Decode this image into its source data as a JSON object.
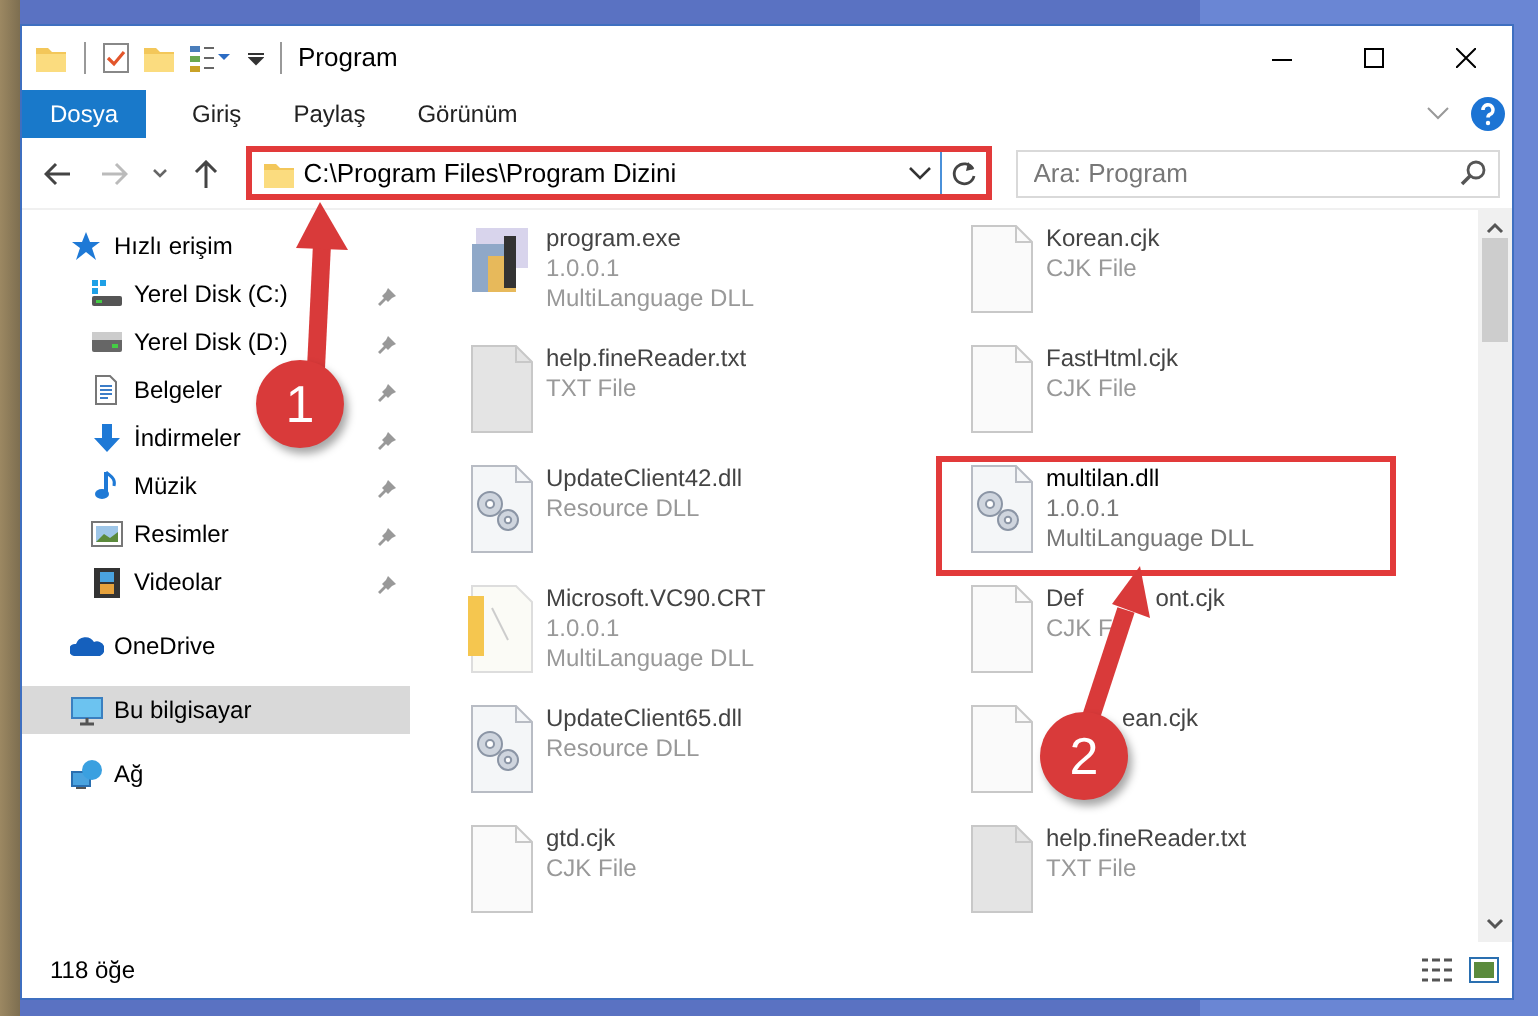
{
  "window": {
    "title": "Program"
  },
  "ribbon_tabs": [
    {
      "label": "Dosya",
      "selected": true
    },
    {
      "label": "Giriş",
      "selected": false
    },
    {
      "label": "Paylaş",
      "selected": false
    },
    {
      "label": "Görünüm",
      "selected": false
    }
  ],
  "address": {
    "path": "C:\\Program Files\\Program Dizini",
    "highlighted": true
  },
  "search": {
    "placeholder": "Ara: Program"
  },
  "nav": [
    {
      "label": "Hızlı erişim",
      "kind": "quick",
      "selected": false,
      "children": [
        {
          "label": "Yerel Disk (C:)",
          "kind": "system-drive",
          "pinned": true,
          "selected": false
        },
        {
          "label": "Yerel Disk (D:)",
          "kind": "drive",
          "pinned": true,
          "selected": false
        },
        {
          "label": "Belgeler",
          "kind": "documents",
          "pinned": true,
          "selected": false
        },
        {
          "label": "İndirmeler",
          "kind": "downloads",
          "pinned": true,
          "selected": false
        },
        {
          "label": "Müzik",
          "kind": "music",
          "pinned": true,
          "selected": false
        },
        {
          "label": "Resimler",
          "kind": "pictures",
          "pinned": true,
          "selected": false
        },
        {
          "label": "Videolar",
          "kind": "videos",
          "pinned": true,
          "selected": false
        }
      ]
    },
    {
      "label": "OneDrive",
      "kind": "cloud",
      "selected": false
    },
    {
      "label": "Bu bilgisayar",
      "kind": "computer",
      "selected": true
    },
    {
      "label": "Ağ",
      "kind": "network",
      "selected": false
    }
  ],
  "files": [
    {
      "name": "program.exe",
      "details": [
        "1.0.0.1",
        "MultiLanguage DLL"
      ],
      "kind": "exe",
      "highlighted": false
    },
    {
      "name": "Korean.cjk",
      "details": [
        "CJK File"
      ],
      "kind": "blank",
      "highlighted": false
    },
    {
      "name": "help.fineReader.txt",
      "details": [
        "TXT File"
      ],
      "kind": "text",
      "highlighted": false
    },
    {
      "name": "FastHtml.cjk",
      "details": [
        "CJK File"
      ],
      "kind": "blank",
      "highlighted": false
    },
    {
      "name": "UpdateClient42.dll",
      "details": [
        "Resource DLL"
      ],
      "kind": "dll",
      "highlighted": false
    },
    {
      "name": "multilan.dll",
      "details": [
        "1.0.0.1",
        "MultiLanguage DLL"
      ],
      "kind": "dll",
      "highlighted": true
    },
    {
      "name": "Microsoft.VC90.CRT",
      "details": [
        "1.0.0.1",
        "MultiLanguage DLL"
      ],
      "kind": "folder",
      "highlighted": false
    },
    {
      "name": "Def",
      "name_end": "ont.cjk",
      "details": [
        "CJK F"
      ],
      "kind": "blank",
      "highlighted": false
    },
    {
      "name": "UpdateClient65.dll",
      "details": [
        "Resource DLL"
      ],
      "kind": "dll",
      "highlighted": false
    },
    {
      "name_end": "ean.cjk",
      "kind": "blank",
      "highlighted": false
    },
    {
      "name": "gtd.cjk",
      "details": [
        "CJK File"
      ],
      "kind": "blank",
      "highlighted": false
    },
    {
      "name": "help.fineReader.txt",
      "details": [
        "TXT File"
      ],
      "kind": "text",
      "highlighted": false
    }
  ],
  "status_bar": {
    "count": "118 öğe"
  },
  "annotations": [
    {
      "number": "1"
    },
    {
      "number": "2"
    }
  ]
}
